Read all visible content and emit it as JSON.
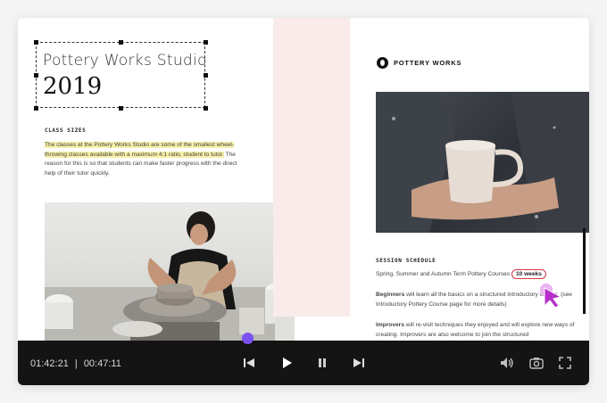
{
  "brochure": {
    "title": "Pottery Works Studio",
    "year": "2019",
    "class_sizes": {
      "heading": "CLASS SIZES",
      "highlighted": "The classes at the Pottery Works Studio are some of the smallest wheel-throwing classes available with a maximum 4:1 ratio, student to tutor.",
      "rest": "The reason for this is so that students can make faster progress with the direct help of their tutor quickly."
    },
    "logo_text": "POTTERY WORKS",
    "schedule": {
      "heading": "SESSION SCHEDULE",
      "intro": "Spring, Summer and Autumn Term Pottery Courses",
      "duration": "10 weeks",
      "beginners_label": "Beginners",
      "beginners_text": "will learn all the basics on a structured introductory course, (see Introductory Pottery Course page for more details)",
      "improvers_label": "Improvers",
      "improvers_text": "will re-visit techniques they enjoyed and will explore new ways of creating. Improvers are also welcome to join the structured"
    }
  },
  "player": {
    "elapsed": "01:42:21",
    "separator": "|",
    "total": "00:47:11",
    "progress_fraction": 0.4,
    "buttons": {
      "prev": "skip-back-icon",
      "play": "play-icon",
      "pause": "pause-icon",
      "next": "skip-forward-icon",
      "volume": "volume-icon",
      "snapshot": "camera-icon",
      "fullscreen": "fullscreen-icon"
    }
  },
  "colors": {
    "accent": "#7b52f0",
    "highlight": "#f6f0a8",
    "pink_panel": "#f9ebea",
    "circle": "#d9363e",
    "cursor": "#b52ec9"
  }
}
